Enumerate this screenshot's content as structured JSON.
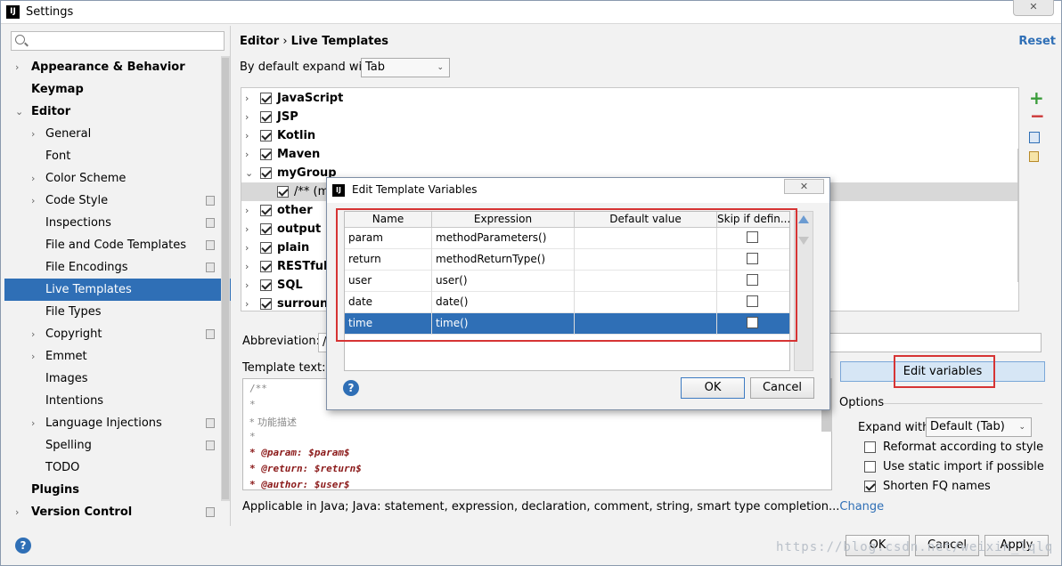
{
  "window": {
    "title": "Settings",
    "logo": "IJ",
    "close_label": "✕"
  },
  "left": {
    "items": [
      {
        "label": "Appearance & Behavior",
        "arrow": "›"
      },
      {
        "label": "Keymap",
        "arrow": ""
      },
      {
        "label": "Editor",
        "arrow": "⌄"
      },
      {
        "label": "General",
        "arrow": "›"
      },
      {
        "label": "Font",
        "arrow": ""
      },
      {
        "label": "Color Scheme",
        "arrow": "›"
      },
      {
        "label": "Code Style",
        "arrow": "›"
      },
      {
        "label": "Inspections",
        "arrow": ""
      },
      {
        "label": "File and Code Templates",
        "arrow": ""
      },
      {
        "label": "File Encodings",
        "arrow": ""
      },
      {
        "label": "Live Templates",
        "arrow": ""
      },
      {
        "label": "File Types",
        "arrow": ""
      },
      {
        "label": "Copyright",
        "arrow": "›"
      },
      {
        "label": "Emmet",
        "arrow": "›"
      },
      {
        "label": "Images",
        "arrow": ""
      },
      {
        "label": "Intentions",
        "arrow": ""
      },
      {
        "label": "Language Injections",
        "arrow": "›"
      },
      {
        "label": "Spelling",
        "arrow": ""
      },
      {
        "label": "TODO",
        "arrow": ""
      },
      {
        "label": "Plugins",
        "arrow": ""
      },
      {
        "label": "Version Control",
        "arrow": "›"
      }
    ],
    "help": "?"
  },
  "header": {
    "breadcrumb_root": "Editor",
    "separator": " › ",
    "breadcrumb_leaf": "Live Templates",
    "reset": "Reset"
  },
  "expand": {
    "label": "By default expand with",
    "value": "Tab"
  },
  "groups": [
    {
      "label": "JavaScript",
      "arrow": "›"
    },
    {
      "label": "JSP",
      "arrow": "›"
    },
    {
      "label": "Kotlin",
      "arrow": "›"
    },
    {
      "label": "Maven",
      "arrow": "›"
    },
    {
      "label": "myGroup",
      "arrow": "⌄"
    },
    {
      "label": "/** (m",
      "arrow": ""
    },
    {
      "label": "other",
      "arrow": "›"
    },
    {
      "label": "output",
      "arrow": "›"
    },
    {
      "label": "plain",
      "arrow": "›"
    },
    {
      "label": "RESTful W",
      "arrow": "›"
    },
    {
      "label": "SQL",
      "arrow": "›"
    },
    {
      "label": "surround",
      "arrow": "›"
    }
  ],
  "abbreviation": {
    "label": "Abbreviation:",
    "value": "/"
  },
  "template": {
    "label": "Template text:",
    "lines": [
      "/**",
      " *",
      " * 功能描述",
      " *",
      " * @param: $param$",
      " * @return: $return$",
      " * @author: $user$"
    ]
  },
  "edit_variables": "Edit variables",
  "options": {
    "title": "Options",
    "expand_label": "Expand with",
    "expand_value": "Default (Tab)",
    "reformat": "Reformat according to style",
    "static_import": "Use static import if possible",
    "shorten": "Shorten FQ names"
  },
  "applicable": {
    "text": "Applicable in Java; Java: statement, expression, declaration, comment, string, smart type completion...",
    "change": "Change"
  },
  "dialog": {
    "title": "Edit Template Variables",
    "close_label": "✕",
    "columns": [
      "Name",
      "Expression",
      "Default value",
      "Skip if defin..."
    ],
    "rows": [
      {
        "name": "param",
        "expression": "methodParameters()",
        "default": ""
      },
      {
        "name": "return",
        "expression": "methodReturnType()",
        "default": ""
      },
      {
        "name": "user",
        "expression": "user()",
        "default": ""
      },
      {
        "name": "date",
        "expression": "date()",
        "default": ""
      },
      {
        "name": "time",
        "expression": "time()",
        "default": ""
      }
    ],
    "ok": "OK",
    "cancel": "Cancel",
    "help": "?"
  },
  "footer": {
    "ok": "OK",
    "cancel": "Cancel",
    "apply": "Apply"
  },
  "watermark": "https://blog.csdn.net/weixin_lqlq",
  "colors": {
    "selection": "#2f6fb6",
    "highlight_box": "#d63434",
    "link": "#2f6fb6"
  }
}
